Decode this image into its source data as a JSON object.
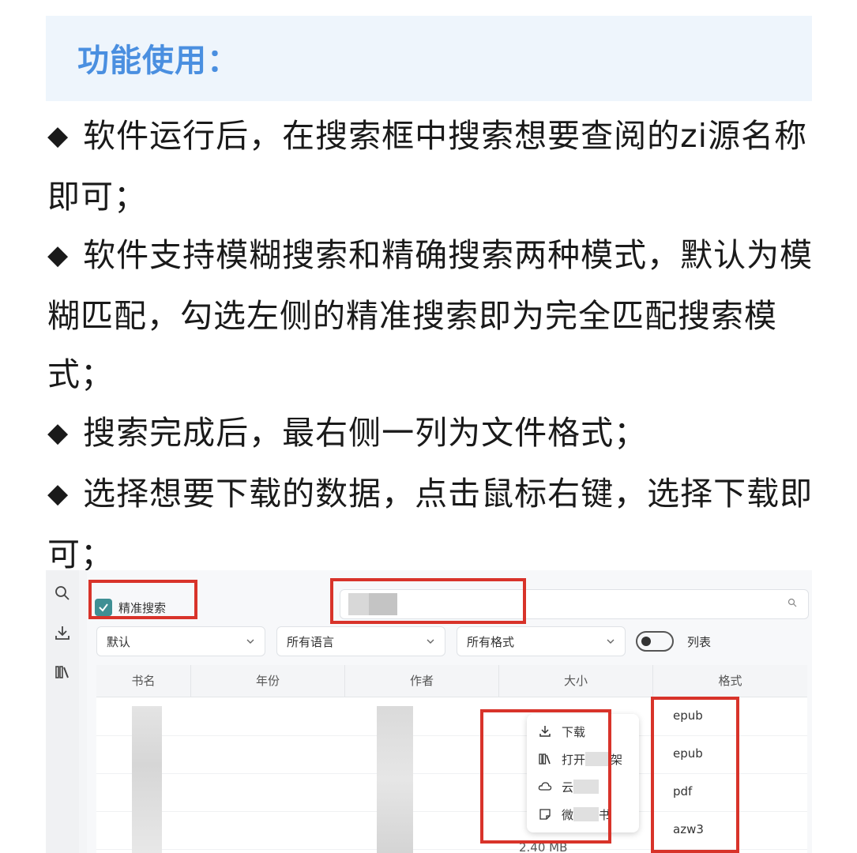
{
  "header": {
    "title": "功能使用："
  },
  "bullets": [
    {
      "marker": "◆",
      "text": "软件运行后，在搜索框中搜索想要查阅的zi源名称即可；"
    },
    {
      "marker": "◆",
      "text": "软件支持模糊搜索和精确搜索两种模式，默认为模糊匹配，勾选左侧的精准搜索即为完全匹配搜索模式；"
    },
    {
      "marker": "◆",
      "text": "搜索完成后，最右侧一列为文件格式；"
    },
    {
      "marker": "◆",
      "text": "选择想要下载的数据，点击鼠标右键，选择下载即可；"
    }
  ],
  "app": {
    "sidebar_icons": [
      "search-icon",
      "download-icon",
      "library-icon"
    ],
    "exact_search": {
      "label": "精准搜索",
      "checked": true
    },
    "search": {
      "placeholder": ""
    },
    "filters": {
      "sort": "默认",
      "language": "所有语言",
      "format": "所有格式"
    },
    "view_toggle": {
      "label": "列表",
      "on": false
    },
    "table": {
      "columns": [
        "书名",
        "年份",
        "作者",
        "大小",
        "格式"
      ],
      "rows": [
        {
          "format": "epub"
        },
        {
          "format": "epub"
        },
        {
          "format": "pdf"
        },
        {
          "format": "azw3"
        }
      ],
      "partial_size": "2.40 MB"
    },
    "context_menu": [
      {
        "icon": "download-icon",
        "pre": "下载",
        "post": ""
      },
      {
        "icon": "library-icon",
        "pre": "打开",
        "post": "架"
      },
      {
        "icon": "cloud-icon",
        "pre": "云",
        "post": ""
      },
      {
        "icon": "note-icon",
        "pre": "微",
        "post": "书"
      }
    ]
  },
  "colors": {
    "accent_title": "#4a8fe0",
    "highlight": "#d8332a",
    "checkbox": "#3f8f94"
  }
}
